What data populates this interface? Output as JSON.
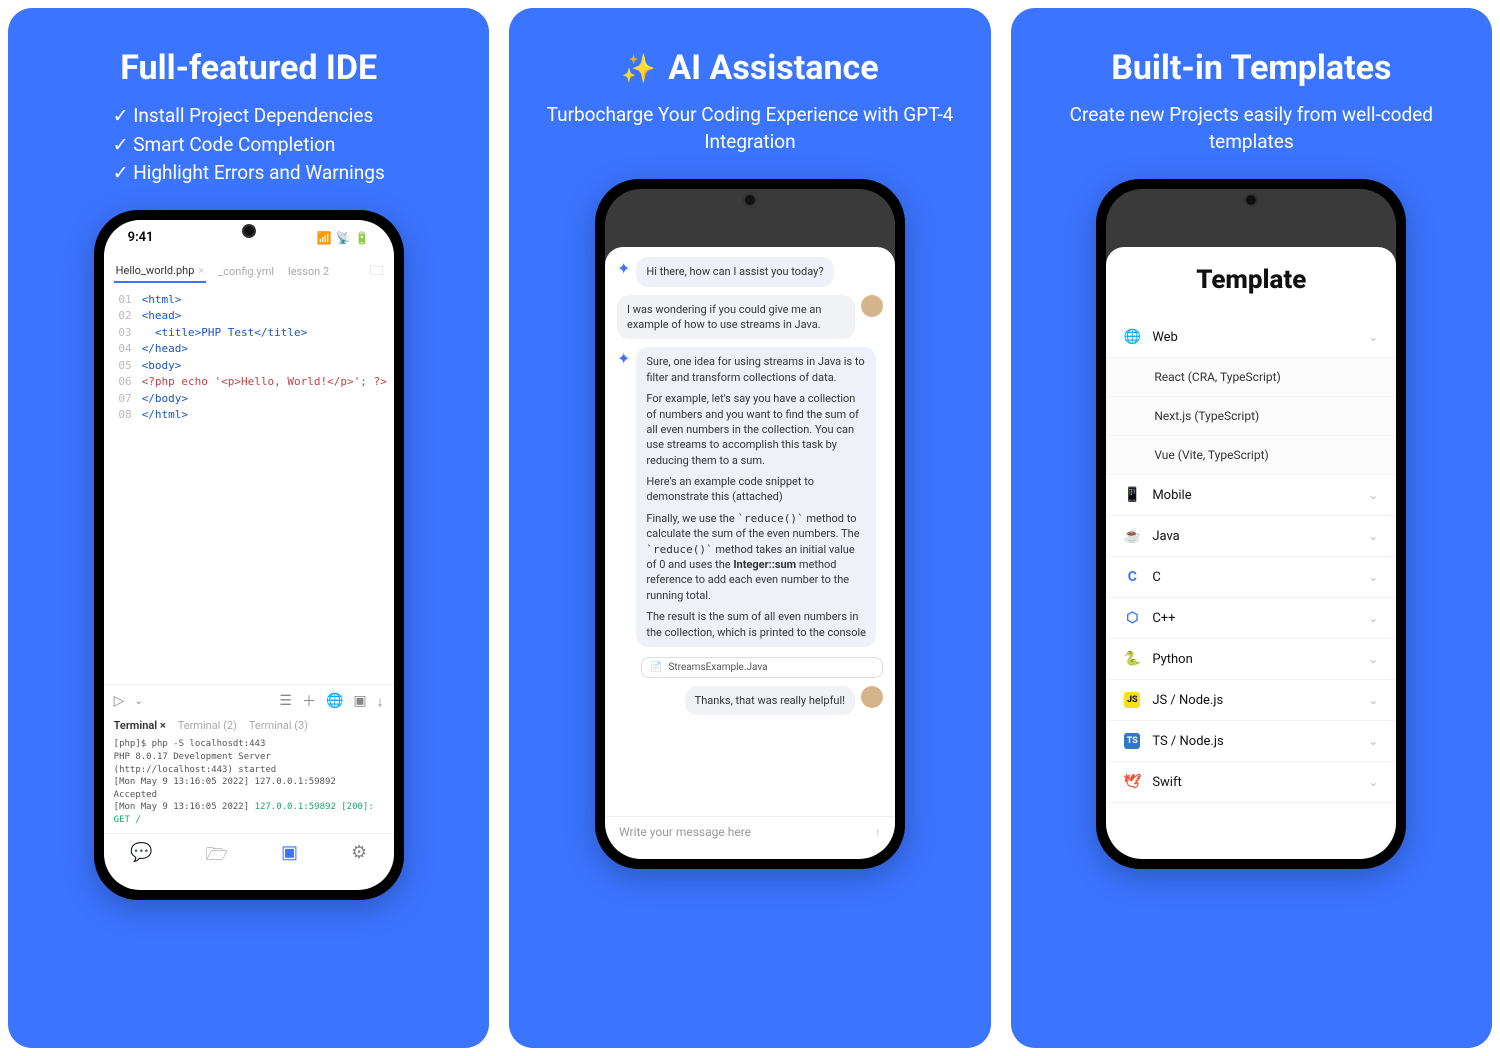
{
  "card1": {
    "title": "Full-featured IDE",
    "features": [
      "Install Project Dependencies",
      "Smart Code Completion",
      "Highlight Errors and Warnings"
    ],
    "statusbar": {
      "time": "9:41"
    },
    "tabs": {
      "active": "Hello_world.php",
      "others": [
        "_config.yml",
        "lesson 2"
      ]
    },
    "code": {
      "lines": [
        {
          "n": "01",
          "html": "<html>"
        },
        {
          "n": "02",
          "html": "<head>"
        },
        {
          "n": "03",
          "html": "  <title>PHP Test</title>"
        },
        {
          "n": "04",
          "html": "</head>"
        },
        {
          "n": "05",
          "html": "<body>"
        },
        {
          "n": "06",
          "html": "<?php echo '<p>Hello, World!</p>'; ?>"
        },
        {
          "n": "07",
          "html": "</body>"
        },
        {
          "n": "08",
          "html": "</html>"
        }
      ]
    },
    "terminal": {
      "tabs": [
        "Terminal",
        "Terminal (2)",
        "Terminal (3)"
      ],
      "lines": [
        "[php]$ php -S localhosdt:443",
        "PHP 8.0.17 Development Server (http://localhost:443) started",
        "[Mon May 9 13:16:05 2022] 127.0.0.1:59892 Accepted",
        "[Mon May 9 13:16:05 2022] 127.0.0.1:59892 [200]: GET /"
      ]
    }
  },
  "card2": {
    "sparkle": "✨",
    "title": "AI Assistance",
    "subtitle": "Turbocharge Your Coding Experience with GPT-4 Integration",
    "chat": {
      "ai_greeting": "Hi there, how can I assist you today?",
      "user_q": "I was wondering if you could give me an example of how to use streams in Java.",
      "ai_answer_p1": "Sure, one idea for using streams in Java is to filter and transform collections of data.",
      "ai_answer_p2": "For example, let's say you have a collection of numbers and you want to find the sum of all even numbers in the collection. You can use streams to accomplish this task by reducing them to a sum.",
      "ai_answer_p3": "Here's an example code snippet to demonstrate this (attached)",
      "ai_answer_p4a": "Finally, we use the ",
      "ai_answer_p4_code1": "`reduce()`",
      "ai_answer_p4b": " method to calculate the sum of the even numbers. The ",
      "ai_answer_p4_code2": "`reduce()`",
      "ai_answer_p4c": " method takes an initial value of 0 and uses the ",
      "ai_answer_p4_strong": "Integer::sum",
      "ai_answer_p4d": " method reference to add each even number to the running total.",
      "ai_answer_p5": "The result is the sum of all even numbers in the collection, which is printed to the console",
      "attachment": "StreamsExample.Java",
      "user_thanks": "Thanks, that was really helpful!",
      "input_placeholder": "Write your message here"
    }
  },
  "card3": {
    "title": "Built-in Templates",
    "subtitle": "Create new Projects easily from well-coded templates",
    "screen_title": "Template",
    "categories": [
      {
        "icon": "🌐",
        "label": "Web",
        "expanded": true,
        "items": [
          "React (CRA, TypeScript)",
          "Next.js (TypeScript)",
          "Vue (Vite, TypeScript)"
        ]
      },
      {
        "icon": "📱",
        "label": "Mobile"
      },
      {
        "icon": "☕",
        "label": "Java"
      },
      {
        "icon": "C",
        "label": "C",
        "color": "#3b74ff"
      },
      {
        "icon": "⬡",
        "label": "C++",
        "color": "#3b74ff"
      },
      {
        "icon": "🐍",
        "label": "Python"
      },
      {
        "icon": "JS",
        "label": "JS / Node.js",
        "bg": "#f7df1e"
      },
      {
        "icon": "TS",
        "label": "TS / Node.js",
        "bg": "#3178c6",
        "fg": "#fff"
      },
      {
        "icon": "🕊",
        "label": "Swift",
        "color": "#f05138"
      }
    ]
  }
}
